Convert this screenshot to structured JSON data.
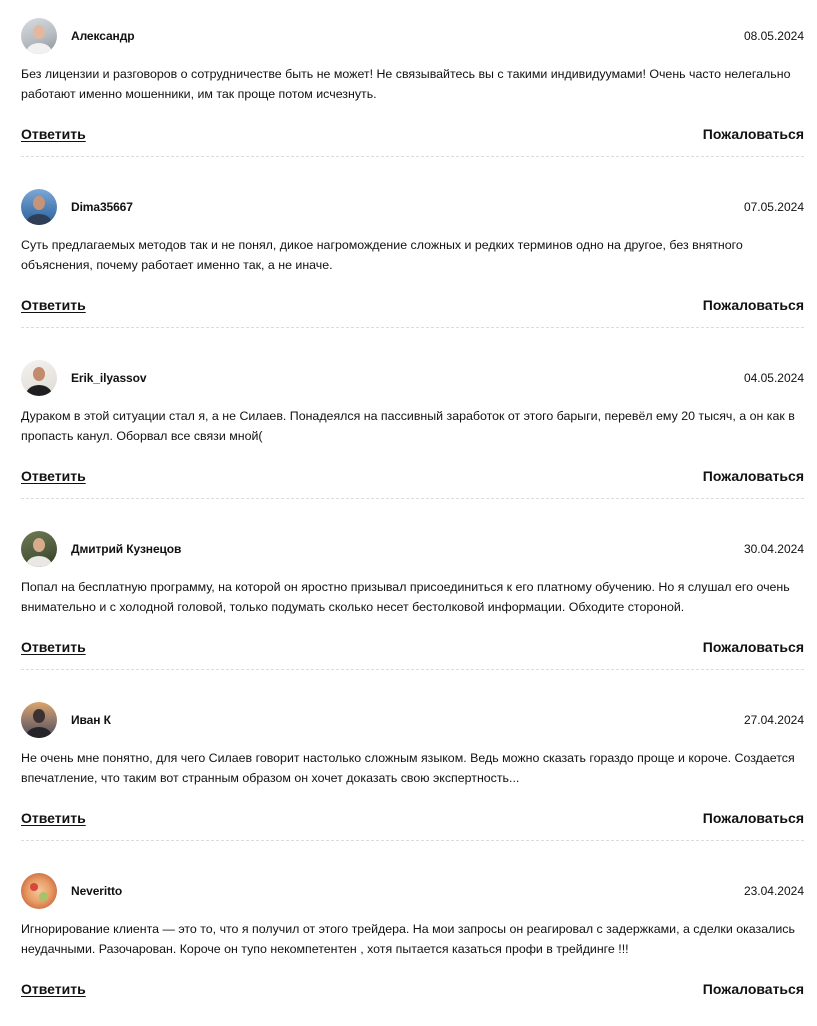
{
  "actions": {
    "reply_label": "Ответить",
    "report_label": "Пожаловаться"
  },
  "comments": [
    {
      "author": "Александр",
      "date": "08.05.2024",
      "text": "Без лицензии и разговоров о сотрудничестве быть не может! Не связывайтесь вы с такими индивидуумами! Очень часто нелегально работают именно мошенники, им так проще потом исчезнуть."
    },
    {
      "author": "Dima35667",
      "date": "07.05.2024",
      "text": "Суть предлагаемых методов так и не понял, дикое нагромождение сложных и редких терминов одно на другое, без внятного объяснения, почему работает именно так, а не иначе."
    },
    {
      "author": "Erik_ilyassov",
      "date": "04.05.2024",
      "text": "Дураком в этой ситуации стал я, а не Силаев. Понадеялся на пассивный заработок от этого барыги, перевёл ему 20 тысяч, а он как в пропасть канул. Оборвал все связи мной("
    },
    {
      "author": "Дмитрий Кузнецов",
      "date": "30.04.2024",
      "text": "Попал на бесплатную программу, на которой он яростно призывал присоединиться к его платному обучению. Но я слушал его очень внимательно и с холодной головой, только подумать сколько несет бестолковой информации. Обходите стороной."
    },
    {
      "author": "Иван К",
      "date": "27.04.2024",
      "text": "Не очень мне понятно, для чего Силаев говорит настолько сложным языком. Ведь можно сказать гораздо проще и короче. Создается впечатление, что таким вот странным образом он хочет доказать свою экспертность..."
    },
    {
      "author": "Neveritto",
      "date": "23.04.2024",
      "text": "Игнорирование клиента — это то, что я получил от этого трейдера. На мои запросы он реагировал с задержками, а сделки оказались неудачными. Разочарован. Короче он тупо некомпетентен , хотя пытается казаться профи в трейдинге !!!"
    }
  ]
}
